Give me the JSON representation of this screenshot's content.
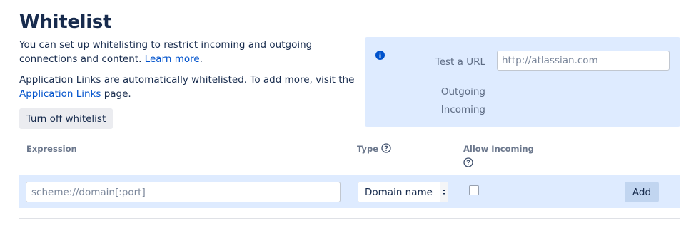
{
  "page": {
    "title": "Whitelist",
    "description_1_text": "You can set up whitelisting to restrict incoming and outgoing connections and content.",
    "learn_more_link": "Learn more",
    "description_1_end": ".",
    "description_2_text": "Application Links are automatically whitelisted. To add more, visit the",
    "application_links_link": "Application Links",
    "description_2_end": "page.",
    "turn_off_button": "Turn off whitelist"
  },
  "test_panel": {
    "test_url_label": "Test a URL",
    "test_url_placeholder": "http://atlassian.com",
    "outgoing_label": "Outgoing",
    "incoming_label": "Incoming",
    "info_icon": "info-icon",
    "background_color": "#deebff"
  },
  "table": {
    "headers": {
      "expression": "Expression",
      "type": "Type",
      "allow_incoming": "Allow Incoming"
    },
    "help_icon": "question-circle-icon",
    "add_row": {
      "expression_placeholder": "scheme://domain[:port]",
      "type_selected": "Domain name",
      "allow_incoming_checked": false,
      "add_button": "Add"
    }
  },
  "colors": {
    "link": "#0052cc",
    "heading": "#172b4d",
    "row_highlight": "#deebff",
    "button_bg": "#ebecf0"
  }
}
